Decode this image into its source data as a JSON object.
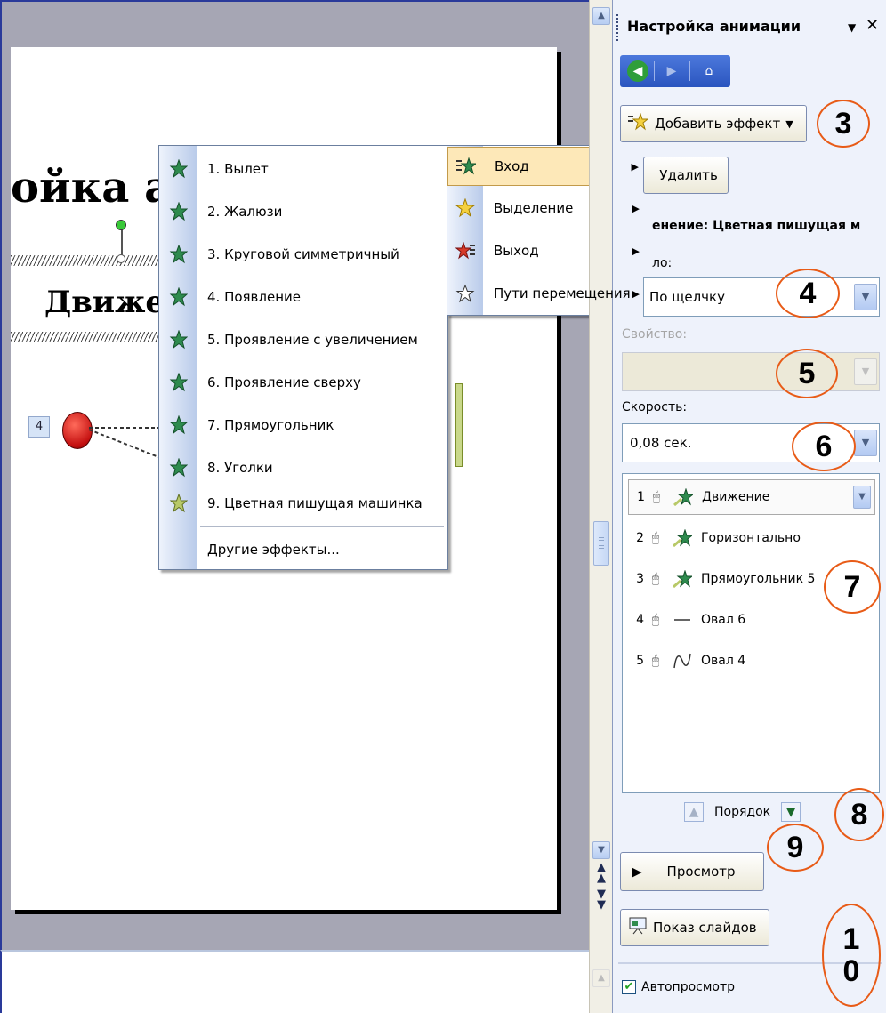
{
  "slide": {
    "title": "ойка анимации",
    "subtitle": "Движение",
    "order_tag": "4"
  },
  "effects_menu": {
    "items": [
      {
        "label": "1. Вылет",
        "icon": "fly-in-star-icon"
      },
      {
        "label": "2. Жалюзи",
        "icon": "blinds-star-icon"
      },
      {
        "label": "3. Круговой симметричный",
        "icon": "circle-star-icon"
      },
      {
        "label": "4. Появление",
        "icon": "appear-star-icon"
      },
      {
        "label": "5. Проявление с увеличением",
        "icon": "zoom-star-icon"
      },
      {
        "label": "6. Проявление сверху",
        "icon": "fade-top-star-icon"
      },
      {
        "label": "7. Прямоугольник",
        "icon": "box-star-icon"
      },
      {
        "label": "8. Уголки",
        "icon": "corners-star-icon"
      },
      {
        "label": "9. Цветная пишущая машинка",
        "icon": "typewriter-star-icon"
      }
    ],
    "more": "Другие эффекты..."
  },
  "effect_type_menu": {
    "items": [
      {
        "label": "Вход",
        "icon": "entrance-icon"
      },
      {
        "label": "Выделение",
        "icon": "emphasis-icon"
      },
      {
        "label": "Выход",
        "icon": "exit-icon"
      },
      {
        "label": "Пути перемещения",
        "icon": "motion-path-icon"
      }
    ]
  },
  "task_pane": {
    "title": "Настройка анимации",
    "add_effect": "Добавить эффект",
    "delete": "Удалить",
    "change_label": "енение: Цветная пишущая м",
    "start_label": "ло:",
    "start_value": "По щелчку",
    "property_label": "Свойство:",
    "speed_label": "Скорость:",
    "speed_value": "0,08 сек.",
    "list": [
      {
        "num": "1",
        "name": "Движение"
      },
      {
        "num": "2",
        "name": "Горизонтально"
      },
      {
        "num": "3",
        "name": "Прямоугольник 5"
      },
      {
        "num": "4",
        "name": "Овал 6"
      },
      {
        "num": "5",
        "name": "Овал 4"
      }
    ],
    "order_label": "Порядок",
    "preview": "Просмотр",
    "slideshow": "Показ слайдов",
    "autopreview": "Автопросмотр"
  },
  "callouts": {
    "c3": "3",
    "c4": "4",
    "c5": "5",
    "c6": "6",
    "c7": "7",
    "c8": "8",
    "c9": "9",
    "c10a": "1",
    "c10b": "0"
  },
  "colors": {
    "accent_orange": "#e85b17",
    "menu_highlight": "#fde8b8",
    "star_green": "#2e8b4e"
  }
}
